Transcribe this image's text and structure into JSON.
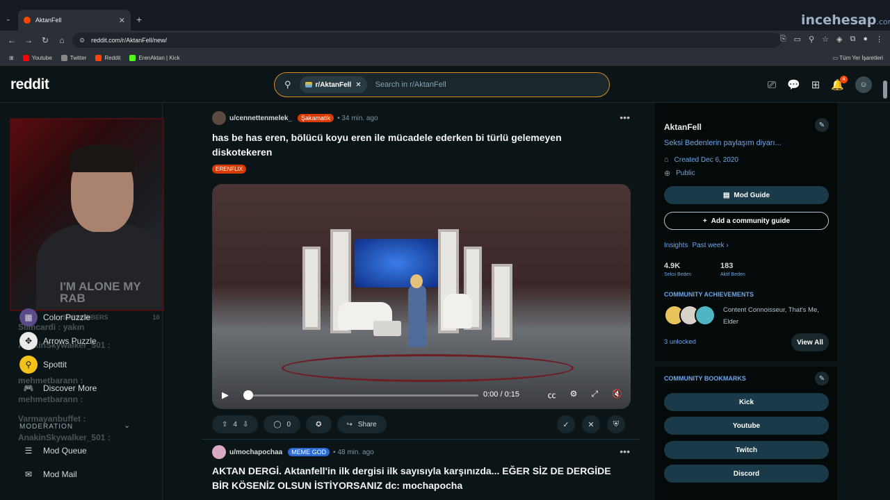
{
  "browser": {
    "tab_title": "AktanFell",
    "new_tab_icon": "+",
    "url": "reddit.com/r/AktanFell/new/",
    "watermark": "incehesap",
    "watermark_suffix": ".com",
    "bookmarks": [
      {
        "label": "Youtube",
        "color": "#ff0000"
      },
      {
        "label": "Twitter",
        "color": "#888888"
      },
      {
        "label": "Reddit",
        "color": "#ff4500"
      },
      {
        "label": "ErenAktan | Kick",
        "color": "#53fc18"
      }
    ],
    "bookmarks_right": "Tüm Yer İşaretleri"
  },
  "reddit": {
    "logo": "reddit",
    "search_chip": "r/AktanFell",
    "search_placeholder": "Search in r/AktanFell",
    "notifications_count": "4"
  },
  "left_sidebar": {
    "nav_items": [
      {
        "label": "Color Puzzle",
        "icon": "color-puzzle-icon"
      },
      {
        "label": "Arrows Puzzle",
        "icon": "arrows-puzzle-icon"
      },
      {
        "label": "Spottit",
        "icon": "spottit-icon"
      },
      {
        "label": "Discover More",
        "icon": "gamepad-icon"
      }
    ],
    "moderation_header": "MODERATION",
    "mod_items": [
      {
        "label": "Mod Queue",
        "icon": "queue-icon"
      },
      {
        "label": "Mod Mail",
        "icon": "mail-icon"
      }
    ],
    "stream_overlay": {
      "shirt_text": "I'M ALONE MY RAB",
      "subscribers_label": "SUBSCRIBERS",
      "subscribers_count": "10",
      "chat": [
        "Slimcardi : yakın",
        "AnakinSkywalker_501 :",
        "mehmetbarann :",
        "mehmetbarann :",
        "Varmayanbuffet :",
        "AnakinSkywalker_501 :"
      ]
    }
  },
  "posts": [
    {
      "username": "u/cennettenmelek_",
      "flair": "Şakamatik",
      "flair_color": "#d93a00",
      "time": "34 min. ago",
      "title": "has be has eren, bölücü koyu eren ile mücadele ederken bi türlü gelemeyen diskotekeren",
      "tag": "ERENFLIX",
      "video_time": "0:00 / 0:15",
      "video_progress": 0,
      "upvotes": "4",
      "comments": "0",
      "share_label": "Share"
    },
    {
      "username": "u/mochapochaa",
      "flair": "MEME GOD",
      "flair_color": "#2b6bd6",
      "time": "48 min. ago",
      "title": "AKTAN DERGİ. Aktanfell'in ilk dergisi ilk sayısıyla karşınızda... EĞER SİZ DE DERGİDE BİR KÖSENİZ OLSUN İSTİYORSANIZ dc: mochapocha"
    }
  ],
  "right_sidebar": {
    "name": "AktanFell",
    "description": "Seksi Bedenlerin paylaşım diyarı...",
    "created": "Created Dec 6, 2020",
    "visibility": "Public",
    "mod_guide": "Mod Guide",
    "add_guide": "Add a community guide",
    "insights": "Insights",
    "insights_range": "Past week ›",
    "stats": [
      {
        "value": "4.9K",
        "label": "Seksi Beden"
      },
      {
        "value": "183",
        "label": "Aktif Beden"
      }
    ],
    "achievements_header": "COMMUNITY ACHIEVEMENTS",
    "achievements_text": "Content Connoisseur, That's Me, Elder",
    "unlocked": "3 unlocked",
    "view_all": "View All",
    "bookmarks_header": "COMMUNITY BOOKMARKS",
    "bookmarks": [
      "Kick",
      "Youtube",
      "Twitch",
      "Discord"
    ]
  }
}
